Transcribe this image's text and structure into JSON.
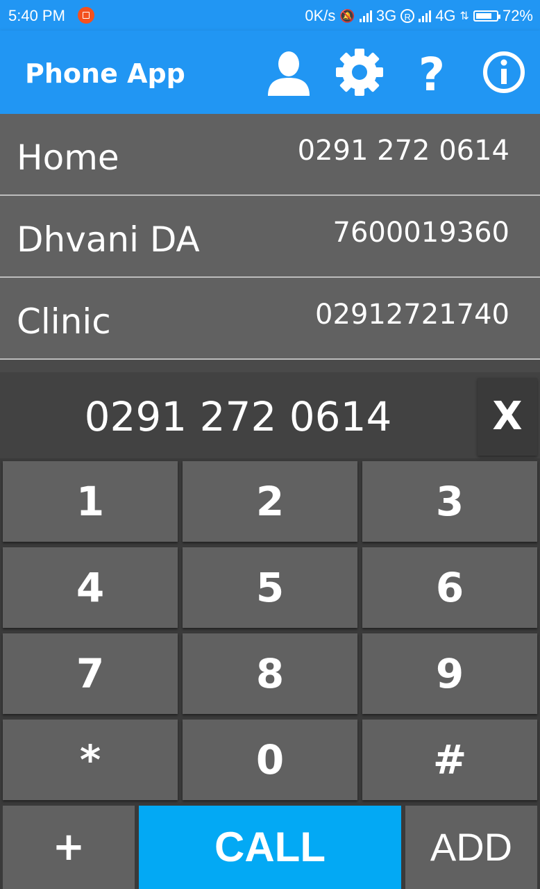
{
  "status_bar": {
    "time": "5:40 PM",
    "net_speed": "0K/s",
    "network1": "3G",
    "roaming": "R",
    "network2": "4G",
    "battery": "72%"
  },
  "app_bar": {
    "title": "Phone App",
    "icons": [
      "person-icon",
      "gear-icon",
      "help-icon",
      "info-icon"
    ],
    "color": "#2196f3"
  },
  "contacts": [
    {
      "name": "Home",
      "number": "0291 272 0614"
    },
    {
      "name": "Dhvani DA",
      "number": "7600019360"
    },
    {
      "name": "Clinic",
      "number": "02912721740"
    }
  ],
  "dialer": {
    "display": "0291 272 0614",
    "clear_label": "X",
    "keys": [
      "1",
      "2",
      "3",
      "4",
      "5",
      "6",
      "7",
      "8",
      "9",
      "*",
      "0",
      "#"
    ],
    "plus_label": "+",
    "call_label": "CALL",
    "add_label": "ADD",
    "call_color": "#03a9f4"
  }
}
